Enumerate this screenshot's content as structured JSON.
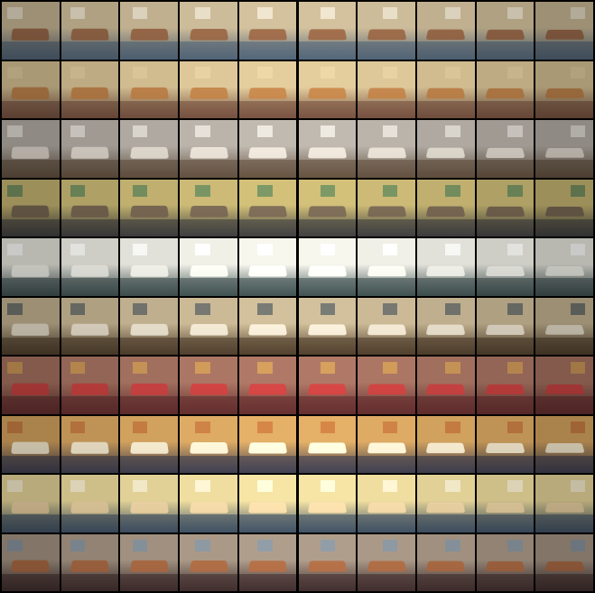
{
  "grid": {
    "rows": 10,
    "cols": 10,
    "background": "#000000",
    "subject": "conference room",
    "row_palettes": [
      {
        "wall": "#b9a98a",
        "table": "#8a5a3c",
        "floor": "#4a5a6a",
        "accent": "#e8e3d8"
      },
      {
        "wall": "#c8b48a",
        "table": "#b0753e",
        "floor": "#6a4a3a",
        "accent": "#d8c49a"
      },
      {
        "wall": "#a8a29a",
        "table": "#d8d2c8",
        "floor": "#5a4a3a",
        "accent": "#f0ede8"
      },
      {
        "wall": "#b8a86a",
        "table": "#6a5a4a",
        "floor": "#3a3a3a",
        "accent": "#2f6a4a"
      },
      {
        "wall": "#d8d8d0",
        "table": "#e8e8e0",
        "floor": "#3a4a4a",
        "accent": "#ffffff"
      },
      {
        "wall": "#b8a888",
        "table": "#e0d8c8",
        "floor": "#4a3a2a",
        "accent": "#2a3a4a"
      },
      {
        "wall": "#9a6a5a",
        "table": "#c03a3a",
        "floor": "#5a2a2a",
        "accent": "#d8a84a"
      },
      {
        "wall": "#c89a5a",
        "table": "#f0e8d0",
        "floor": "#3a3a4a",
        "accent": "#b05a2a"
      },
      {
        "wall": "#d8c890",
        "table": "#e0c89a",
        "floor": "#3a4a5a",
        "accent": "#f4f0e8"
      },
      {
        "wall": "#9a8a7a",
        "table": "#a0603a",
        "floor": "#3a2a2a",
        "accent": "#6a8aa8"
      }
    ]
  }
}
